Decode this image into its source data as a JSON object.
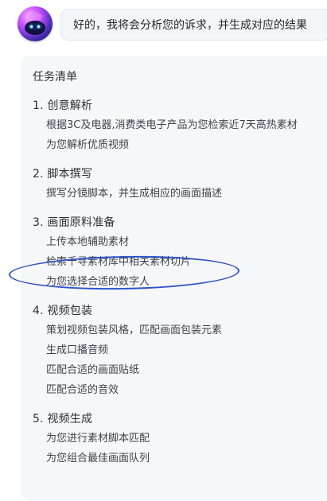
{
  "message": {
    "text": "好的，我将会分析您的诉求，并生成对应的结果"
  },
  "tasklist": {
    "title": "任务清单",
    "sections": [
      {
        "title": "1. 创意解析",
        "items": [
          "根据3C及电器,消费类电子产品为您检索近7天高热素材",
          "为您解析优质视频"
        ]
      },
      {
        "title": "2. 脚本撰写",
        "items": [
          "撰写分镜脚本，并生成相应的画面描述"
        ]
      },
      {
        "title": "3. 画面原料准备",
        "items": [
          "上传本地辅助素材",
          "检索千寻素材库中相关素材切片",
          "为您选择合适的数字人"
        ]
      },
      {
        "title": "4. 视频包装",
        "items": [
          "策划视频包装风格，匹配画面包装元素",
          "生成口播音频",
          "匹配合适的画面贴纸",
          "匹配合适的音效"
        ]
      },
      {
        "title": "5. 视频生成",
        "items": [
          "为您进行素材脚本匹配",
          "为您组合最佳画面队列"
        ]
      }
    ]
  },
  "colors": {
    "highlight_ellipse": "#2f53c8",
    "card_bg": "#f6f7f9",
    "bubble_bg": "#f4f5f8"
  }
}
